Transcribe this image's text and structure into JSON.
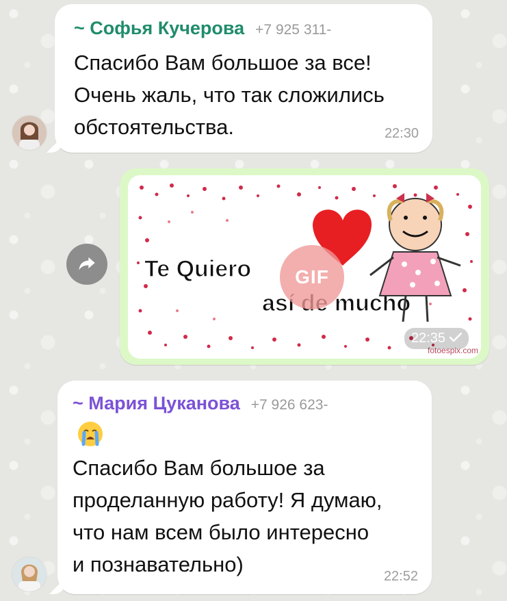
{
  "messages": [
    {
      "type": "text",
      "direction": "incoming",
      "sender": "~ Софья Кучерова",
      "phone": "+7 925 311-",
      "lines": [
        "Спасибо Вам большое за все!",
        "Очень жаль, что так сложились",
        "обстоятельства."
      ],
      "time": "22:30",
      "name_color": "#1f8c6c"
    },
    {
      "type": "gif",
      "direction": "outgoing",
      "badge": "GIF",
      "time": "22:35",
      "gif_text_line1": "Te Quiero",
      "gif_text_line2": "así de mucho",
      "watermark": "fotoespix.com"
    },
    {
      "type": "text",
      "direction": "incoming",
      "sender": "~ Мария Цуканова",
      "phone": "+7 926 623-",
      "lines": [
        "Спасибо Вам большое за",
        "проделанную работу! Я думаю,",
        "что нам всем было интересно",
        "и познавательно)"
      ],
      "time": "22:52",
      "name_color": "#7b52d6",
      "emoji": "crying-face"
    }
  ],
  "icons": {
    "forward": "forward-arrow-icon",
    "checkmark": "checkmark-icon"
  },
  "colors": {
    "outgoing_bubble": "#dcf8c7",
    "incoming_bubble": "#ffffff",
    "background": "#e6e6e2"
  }
}
